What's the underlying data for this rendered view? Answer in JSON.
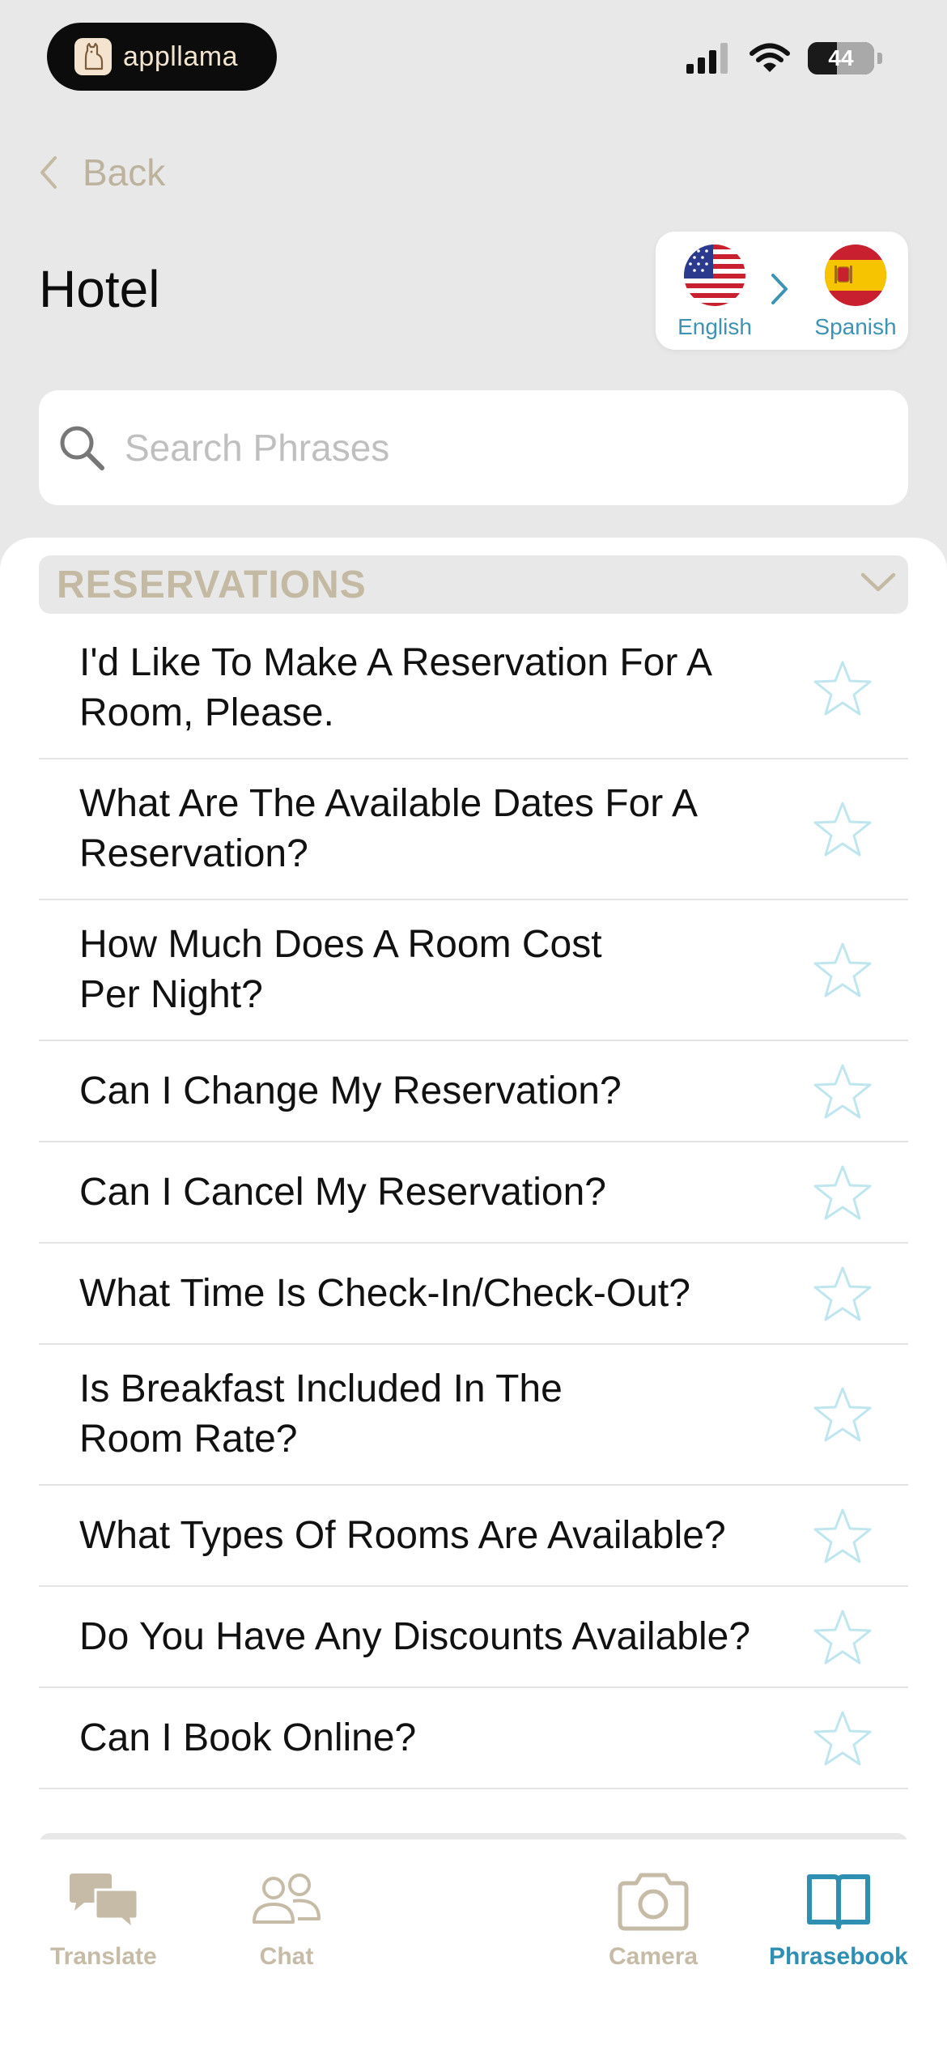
{
  "status_bar": {
    "app_pill_name": "appllama",
    "battery_level": "44",
    "battery_percent": 44
  },
  "nav": {
    "back_label": "Back"
  },
  "page": {
    "title": "Hotel"
  },
  "language": {
    "from": {
      "label": "English",
      "flag": "us-flag-icon"
    },
    "to": {
      "label": "Spanish",
      "flag": "spain-flag-icon"
    }
  },
  "search": {
    "placeholder": "Search Phrases",
    "value": ""
  },
  "section": {
    "title": "RESERVATIONS",
    "expanded": true
  },
  "phrases": [
    {
      "text": "I'd Like To Make A Reservation For A Room, Please.",
      "favorite": false
    },
    {
      "text": "What Are The Available Dates For A Reservation?",
      "favorite": false
    },
    {
      "text": "How Much Does A Room Cost Per Night?",
      "favorite": false
    },
    {
      "text": "Can I Change My Reservation?",
      "favorite": false
    },
    {
      "text": "Can I Cancel My Reservation?",
      "favorite": false
    },
    {
      "text": "What Time Is Check-In/Check-Out?",
      "favorite": false
    },
    {
      "text": "Is Breakfast Included In The Room Rate?",
      "favorite": false
    },
    {
      "text": "What Types Of Rooms Are Available?",
      "favorite": false
    },
    {
      "text": "Do You Have Any Discounts Available?",
      "favorite": false
    },
    {
      "text": "Can I Book Online?",
      "favorite": false
    }
  ],
  "tabs": [
    {
      "label": "Translate",
      "active": false
    },
    {
      "label": "Chat",
      "active": false
    },
    {
      "label": "Camera",
      "active": false
    },
    {
      "label": "Phrasebook",
      "active": true
    }
  ],
  "colors": {
    "accent": "#2e8fb3",
    "muted": "#c6bba6",
    "star_outline": "#bfe6ee",
    "background": "#e8e8e8"
  }
}
